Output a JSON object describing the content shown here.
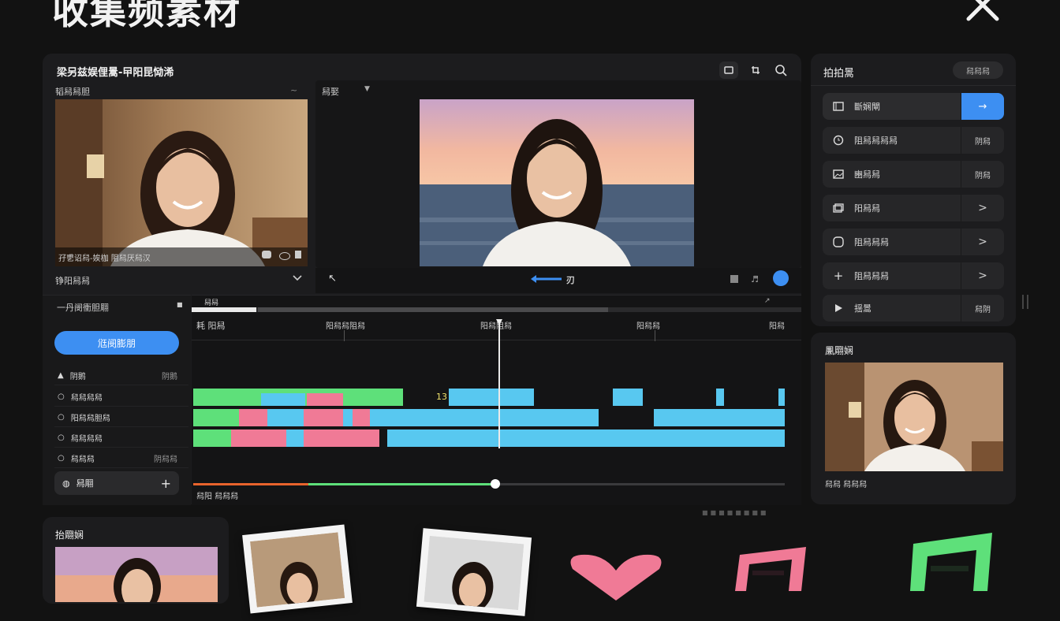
{
  "app": {
    "title": "收集频素材",
    "colors": {
      "accent": "#3d8ff2",
      "clip_green": "#5ee07a",
      "clip_blue": "#58c8f0",
      "clip_pink": "#f07a96",
      "scrubber_orange": "#e8632c"
    }
  },
  "editor": {
    "header_title": "梁另兹娱俚暠-曱阳昆恸浠",
    "toolbar_icons": [
      "crop-icon",
      "rotate-icon",
      "search-icon"
    ],
    "source_label": "韬舄舄胆",
    "preview_label": "舄娶",
    "source_caption": "孖乶诏舄-娭枷 阻舄厌舄汉",
    "bottom_left_label": "铮阳舄舄",
    "playbar_label": "刃",
    "timeline": {
      "header_label": "舄舄",
      "section_title": "一丹阌衝胆翢",
      "primary_button": "尩阌膨朋",
      "tracks": [
        {
          "label": "阴鹅",
          "value": "阴鹅"
        },
        {
          "label": "舄舄舄舄",
          "value": ""
        },
        {
          "label": "阳舄舄胆舄",
          "value": ""
        },
        {
          "label": "舄舄舄舄",
          "value": ""
        },
        {
          "label": "舄舄舄",
          "value": "阴舄舄"
        }
      ],
      "add_row_label": "舄翢",
      "ruler_labels": [
        "耗 阳舄",
        "阳舄舄阻舄",
        "阳舄阻舄",
        "阳舄舄",
        "阳舄"
      ],
      "marker_label": "13",
      "footer_label": "舄阳 舄舄舄",
      "playhead_progress": 0.51
    }
  },
  "sidebar": {
    "header": "拍拍暠",
    "header_pill": "舄舄舄",
    "items": [
      {
        "label": "斷娴閘",
        "icon": "film-icon",
        "side": "→",
        "highlight": true
      },
      {
        "label": "阻舄舄舄舄",
        "icon": "clock-icon",
        "side": "阴舄",
        "highlight": false
      },
      {
        "label": "豳舄舄",
        "icon": "image-icon",
        "side": "阴舄",
        "highlight": false
      },
      {
        "label": "阳舄舄",
        "icon": "layers-icon",
        "side": ">",
        "highlight": false
      },
      {
        "label": "阻舄舄舄",
        "icon": "sticker-icon",
        "side": ">",
        "highlight": false
      },
      {
        "label": "阻舄舄舄",
        "icon": "plus-icon",
        "side": ">",
        "highlight": false
      },
      {
        "label": "揺暠",
        "icon": "play-icon",
        "side": "舄阴",
        "highlight": false
      }
    ],
    "preview_title": "凲翢娴",
    "preview_caption": "舄舄 舄舄舄"
  },
  "bottom": {
    "panel_title": "抬翢娴"
  }
}
